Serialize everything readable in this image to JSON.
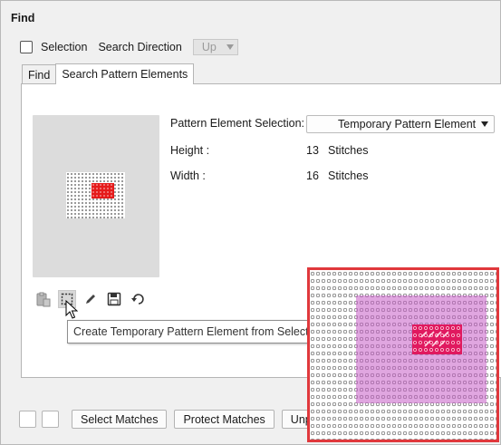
{
  "window": {
    "title": "Find"
  },
  "options": {
    "selection_label": "Selection",
    "search_direction_label": "Search Direction",
    "direction_value": "Up"
  },
  "tabs": [
    {
      "label": "Find",
      "active": false
    },
    {
      "label": "Search Pattern Elements",
      "active": true
    }
  ],
  "pattern": {
    "selection_label": "Pattern Element Selection:",
    "selection_value": "Temporary Pattern Element",
    "height_label": "Height :",
    "height_value": "13",
    "height_unit": "Stitches",
    "width_label": "Width :",
    "width_value": "16",
    "width_unit": "Stitches"
  },
  "toolbar": {
    "icons": [
      "clipboard-icon",
      "select-rectangle-icon",
      "pencil-icon",
      "save-icon",
      "undo-icon"
    ],
    "tooltip": "Create Temporary Pattern Element from Selection"
  },
  "buttons": {
    "select_matches": "Select Matches",
    "protect_matches": "Protect Matches",
    "unprotect_partial": "Unpro"
  },
  "colors": {
    "highlight_border": "#e0383c",
    "selection_overlay": "#c75dc7",
    "pattern_fill": "#e0195f",
    "preview_fill": "#e51b1b"
  }
}
